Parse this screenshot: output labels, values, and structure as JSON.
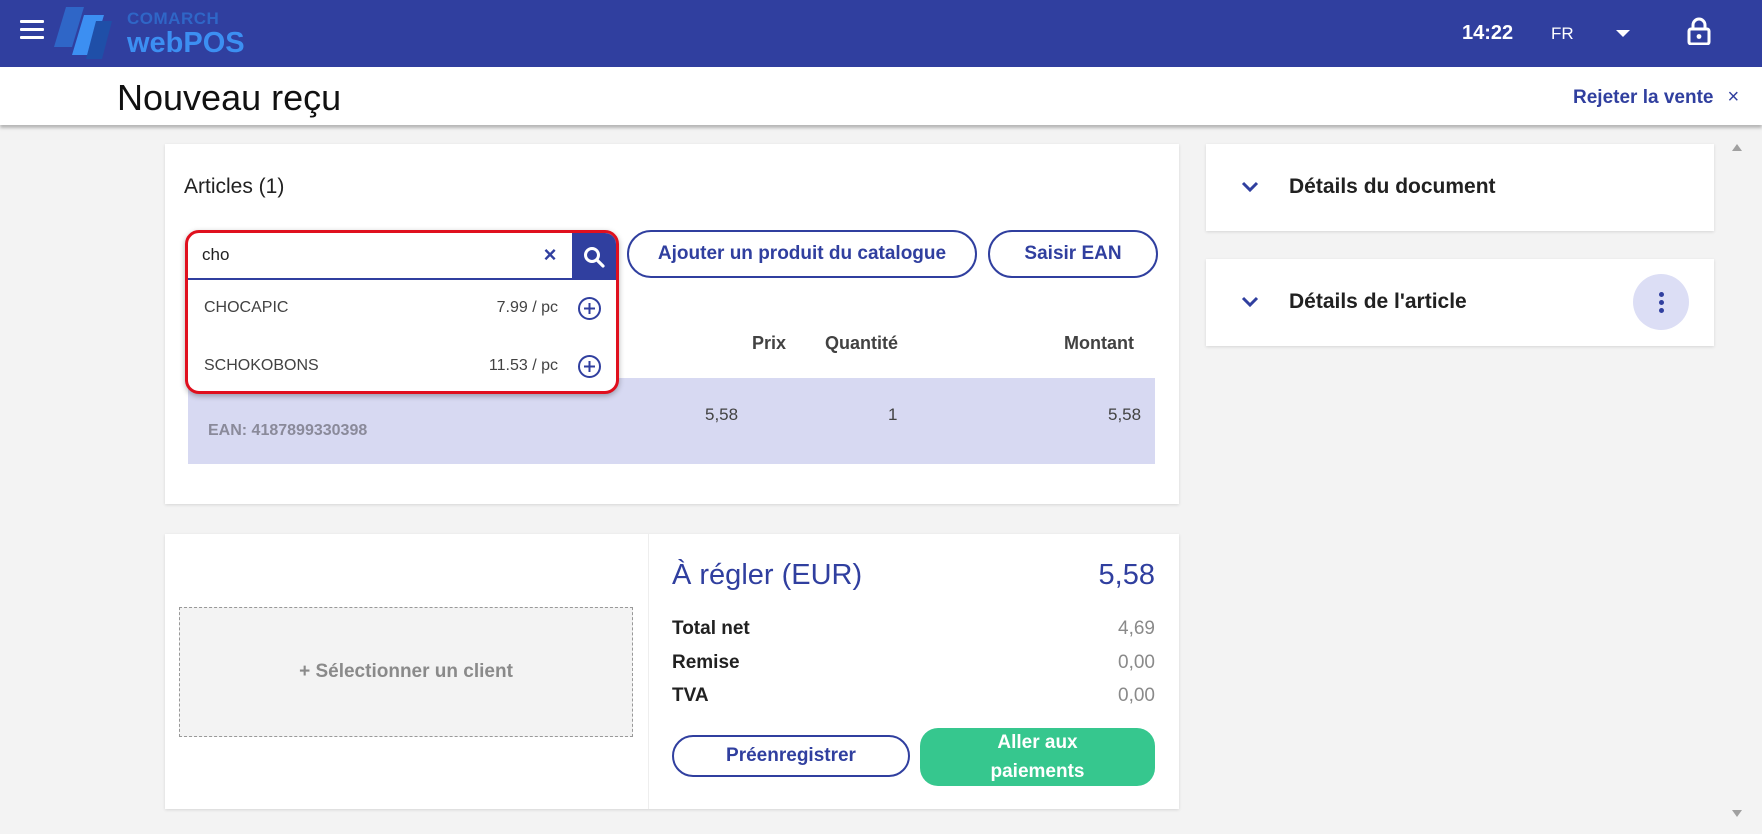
{
  "app": {
    "brand_company": "COMARCH",
    "brand_product": "webPOS",
    "clock": "14:22",
    "language": "FR",
    "icons": {
      "menu": "hamburger-icon",
      "language_dropdown": "caret-down-icon",
      "lock": "lock-icon"
    }
  },
  "header": {
    "title": "Nouveau reçu",
    "reject_label": "Rejeter la vente",
    "reject_icon": "×"
  },
  "articles": {
    "title": "Articles (1)",
    "add_from_catalog_label": "Ajouter un produit du catalogue",
    "enter_ean_label": "Saisir EAN",
    "columns": {
      "price": "Prix",
      "quantity": "Quantité",
      "amount": "Montant"
    },
    "rows": [
      {
        "ean": "EAN: 4187899330398",
        "price": "5,58",
        "quantity": "1",
        "amount": "5,58",
        "selected": true
      }
    ]
  },
  "search": {
    "value": "cho",
    "clear_icon": "×",
    "results": [
      {
        "name": "CHOCAPIC",
        "price": "7.99 / pc"
      },
      {
        "name": "SCHOKOBONS",
        "price": "11.53 / pc"
      }
    ]
  },
  "summary": {
    "select_client_label": "+ Sélectionner un client",
    "due_label": "À régler (EUR)",
    "due_value": "5,58",
    "lines": [
      {
        "label": "Total net",
        "value": "4,69"
      },
      {
        "label": "Remise",
        "value": "0,00"
      },
      {
        "label": "TVA",
        "value": "0,00"
      }
    ],
    "preregister_label": "Préenregistrer",
    "pay_label_line1": "Aller aux",
    "pay_label_line2": "paiements"
  },
  "panels": {
    "document_details": "Détails du document",
    "article_details": "Détails de l'article"
  },
  "colors": {
    "primary": "#303f9f",
    "accent_green": "#36c78e",
    "selected_row": "#d7d9f2",
    "highlight_border": "#e0101e"
  }
}
